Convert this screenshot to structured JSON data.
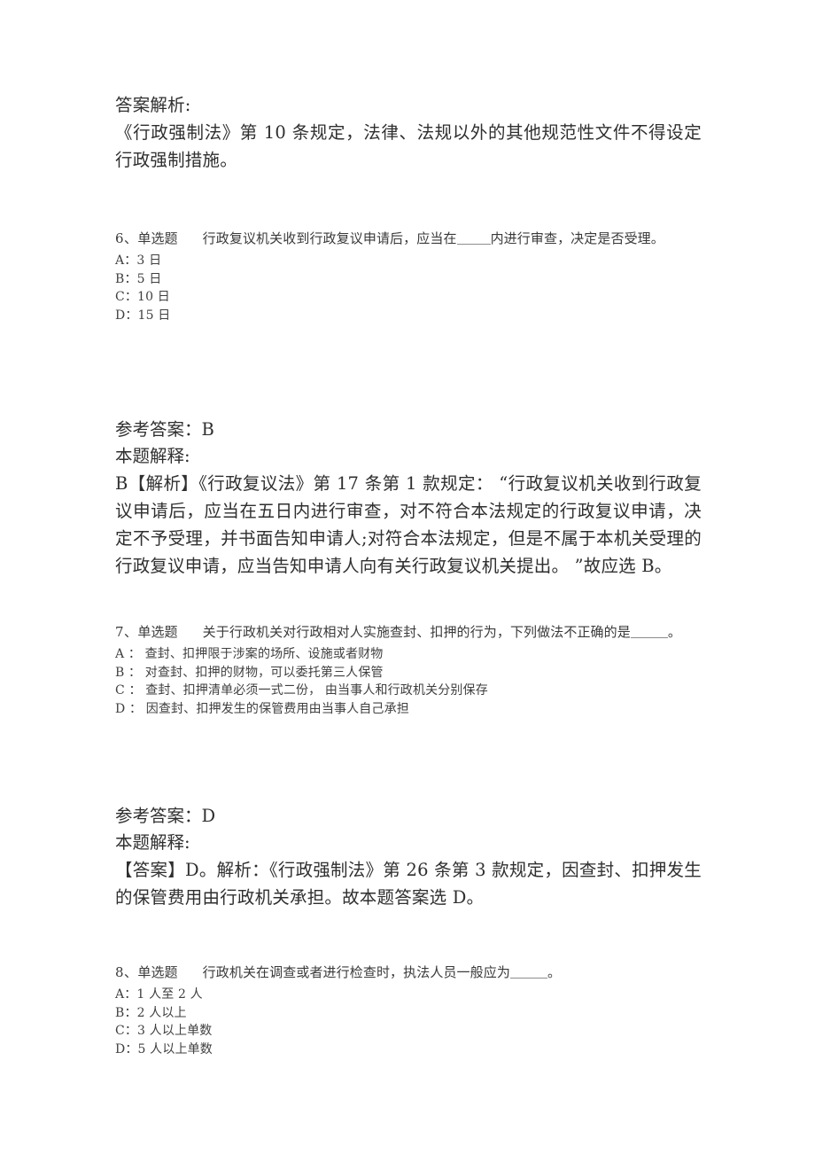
{
  "document": {
    "intro": {
      "answer_analysis_label": "答案解析:",
      "analysis_text": "《行政强制法》第 10 条规定，法律、法规以外的其他规范性文件不得设定行政强制措施。"
    },
    "questions": [
      {
        "number": "6、",
        "type": "单选题",
        "stem_before_blank": "行政复议机关收到行政复议申请后，应当在",
        "stem_after_blank": "内进行审查，决定是否受理。",
        "options": [
          "A：3 日",
          "B：5 日",
          "C：10 日",
          "D：15 日"
        ],
        "reference_answer_label": "参考答案：",
        "reference_answer_value": "B",
        "explanation_label": "本题解释:",
        "explanation_text": "B【解析】《行政复议法》第 17 条第 1 款规定： “行政复议机关收到行政复议申请后，应当在五日内进行审查，对不符合本法规定的行政复议申请，决定不予受理，并书面告知申请人;对符合本法规定，但是不属于本机关受理的行政复议申请，应当告知申请人向有关行政复议机关提出。 ”故应选 B。"
      },
      {
        "number": "7、",
        "type": "单选题",
        "stem_before_blank": "关于行政机关对行政相对人实施查封、扣押的行为，下列做法不正确的是",
        "stem_after_blank": "。",
        "options": [
          "A ： 查封、扣押限于涉案的场所、设施或者财物",
          "B ： 对查封、扣押的财物，可以委托第三人保管",
          "C ： 查封、扣押清单必须一式二份， 由当事人和行政机关分别保存",
          "D ： 因查封、扣押发生的保管费用由当事人自己承担"
        ],
        "reference_answer_label": "参考答案：",
        "reference_answer_value": "D",
        "explanation_label": "本题解释:",
        "explanation_text": "【答案】D。解析：《行政强制法》第 26 条第 3 款规定，因查封、扣押发生的保管费用由行政机关承担。故本题答案选 D。"
      },
      {
        "number": "8、",
        "type": "单选题",
        "stem_before_blank": "行政机关在调查或者进行检查时，执法人员一般应为",
        "stem_after_blank": "。",
        "options": [
          "A：1 人至 2 人",
          "B：2 人以上",
          "C：3 人以上单数",
          "D：5 人以上单数"
        ]
      }
    ]
  }
}
